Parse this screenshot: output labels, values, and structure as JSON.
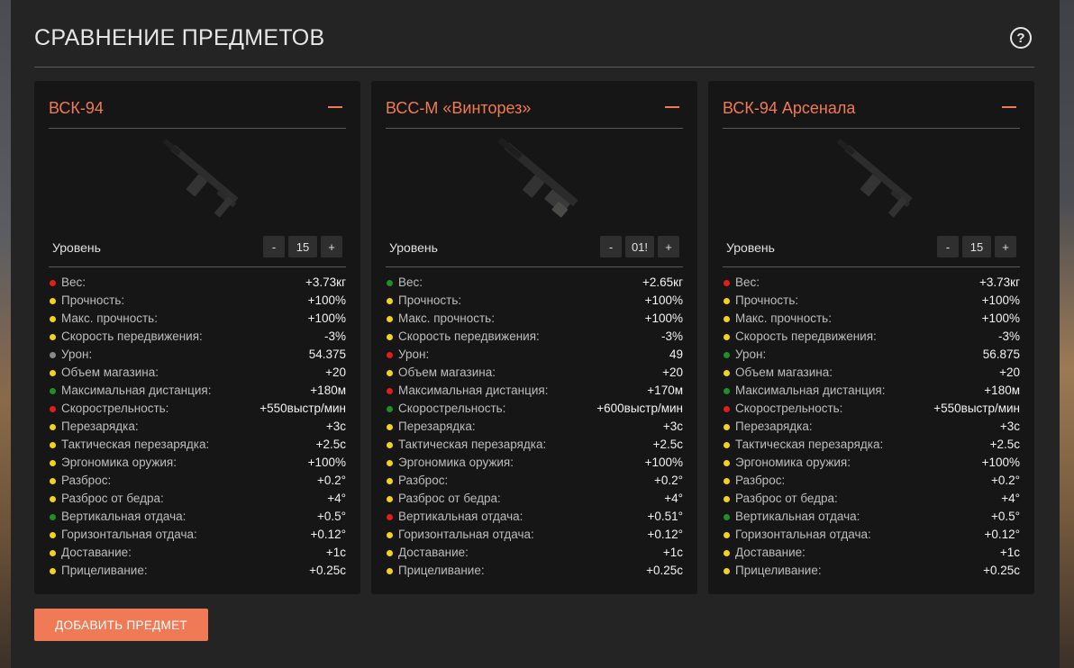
{
  "page": {
    "title": "СРАВНЕНИЕ ПРЕДМЕТОВ",
    "help_icon": "question-circle-icon",
    "help_glyph": "?",
    "add_button": "ДОБАВИТЬ ПРЕДМЕТ"
  },
  "colors": {
    "accent": "#f07a55",
    "red": "#e11d1d",
    "yellow": "#f2d21a",
    "green": "#1f8f2a",
    "gray": "#8a8a8a"
  },
  "level_label": "Уровень",
  "stepper": {
    "minus": "-",
    "plus": "+"
  },
  "items": [
    {
      "name": "ВСК-94",
      "level": "15",
      "weapon_icon": "rifle-image",
      "stats": [
        {
          "label": "Вес:",
          "value": "+3.73кг",
          "status": "red"
        },
        {
          "label": "Прочность:",
          "value": "+100%",
          "status": "yellow"
        },
        {
          "label": "Макс. прочность:",
          "value": "+100%",
          "status": "yellow"
        },
        {
          "label": "Скорость передвижения:",
          "value": "-3%",
          "status": "yellow"
        },
        {
          "label": "Урон:",
          "value": "54.375",
          "status": "gray"
        },
        {
          "label": "Объем магазина:",
          "value": "+20",
          "status": "yellow"
        },
        {
          "label": "Максимальная дистанция:",
          "value": "+180м",
          "status": "green"
        },
        {
          "label": "Скорострельность:",
          "value": "+550выстр/мин",
          "status": "red"
        },
        {
          "label": "Перезарядка:",
          "value": "+3с",
          "status": "yellow"
        },
        {
          "label": "Тактическая перезарядка:",
          "value": "+2.5с",
          "status": "yellow"
        },
        {
          "label": "Эргономика оружия:",
          "value": "+100%",
          "status": "yellow"
        },
        {
          "label": "Разброс:",
          "value": "+0.2°",
          "status": "yellow"
        },
        {
          "label": "Разброс от бедра:",
          "value": "+4°",
          "status": "yellow"
        },
        {
          "label": "Вертикальная отдача:",
          "value": "+0.5°",
          "status": "green"
        },
        {
          "label": "Горизонтальная отдача:",
          "value": "+0.12°",
          "status": "yellow"
        },
        {
          "label": "Доставание:",
          "value": "+1с",
          "status": "yellow"
        },
        {
          "label": "Прицеливание:",
          "value": "+0.25с",
          "status": "yellow"
        }
      ]
    },
    {
      "name": "ВСС-М «Винторез»",
      "level": "01!",
      "weapon_icon": "rifle-image",
      "stats": [
        {
          "label": "Вес:",
          "value": "+2.65кг",
          "status": "green"
        },
        {
          "label": "Прочность:",
          "value": "+100%",
          "status": "yellow"
        },
        {
          "label": "Макс. прочность:",
          "value": "+100%",
          "status": "yellow"
        },
        {
          "label": "Скорость передвижения:",
          "value": "-3%",
          "status": "yellow"
        },
        {
          "label": "Урон:",
          "value": "49",
          "status": "red"
        },
        {
          "label": "Объем магазина:",
          "value": "+20",
          "status": "yellow"
        },
        {
          "label": "Максимальная дистанция:",
          "value": "+170м",
          "status": "red"
        },
        {
          "label": "Скорострельность:",
          "value": "+600выстр/мин",
          "status": "green"
        },
        {
          "label": "Перезарядка:",
          "value": "+3с",
          "status": "yellow"
        },
        {
          "label": "Тактическая перезарядка:",
          "value": "+2.5с",
          "status": "yellow"
        },
        {
          "label": "Эргономика оружия:",
          "value": "+100%",
          "status": "yellow"
        },
        {
          "label": "Разброс:",
          "value": "+0.2°",
          "status": "yellow"
        },
        {
          "label": "Разброс от бедра:",
          "value": "+4°",
          "status": "yellow"
        },
        {
          "label": "Вертикальная отдача:",
          "value": "+0.51°",
          "status": "red"
        },
        {
          "label": "Горизонтальная отдача:",
          "value": "+0.12°",
          "status": "yellow"
        },
        {
          "label": "Доставание:",
          "value": "+1с",
          "status": "yellow"
        },
        {
          "label": "Прицеливание:",
          "value": "+0.25с",
          "status": "yellow"
        }
      ]
    },
    {
      "name": "ВСК-94 Арсенала",
      "level": "15",
      "weapon_icon": "rifle-image",
      "stats": [
        {
          "label": "Вес:",
          "value": "+3.73кг",
          "status": "red"
        },
        {
          "label": "Прочность:",
          "value": "+100%",
          "status": "yellow"
        },
        {
          "label": "Макс. прочность:",
          "value": "+100%",
          "status": "yellow"
        },
        {
          "label": "Скорость передвижения:",
          "value": "-3%",
          "status": "yellow"
        },
        {
          "label": "Урон:",
          "value": "56.875",
          "status": "green"
        },
        {
          "label": "Объем магазина:",
          "value": "+20",
          "status": "yellow"
        },
        {
          "label": "Максимальная дистанция:",
          "value": "+180м",
          "status": "green"
        },
        {
          "label": "Скорострельность:",
          "value": "+550выстр/мин",
          "status": "red"
        },
        {
          "label": "Перезарядка:",
          "value": "+3с",
          "status": "yellow"
        },
        {
          "label": "Тактическая перезарядка:",
          "value": "+2.5с",
          "status": "yellow"
        },
        {
          "label": "Эргономика оружия:",
          "value": "+100%",
          "status": "yellow"
        },
        {
          "label": "Разброс:",
          "value": "+0.2°",
          "status": "yellow"
        },
        {
          "label": "Разброс от бедра:",
          "value": "+4°",
          "status": "yellow"
        },
        {
          "label": "Вертикальная отдача:",
          "value": "+0.5°",
          "status": "green"
        },
        {
          "label": "Горизонтальная отдача:",
          "value": "+0.12°",
          "status": "yellow"
        },
        {
          "label": "Доставание:",
          "value": "+1с",
          "status": "yellow"
        },
        {
          "label": "Прицеливание:",
          "value": "+0.25с",
          "status": "yellow"
        }
      ]
    }
  ]
}
